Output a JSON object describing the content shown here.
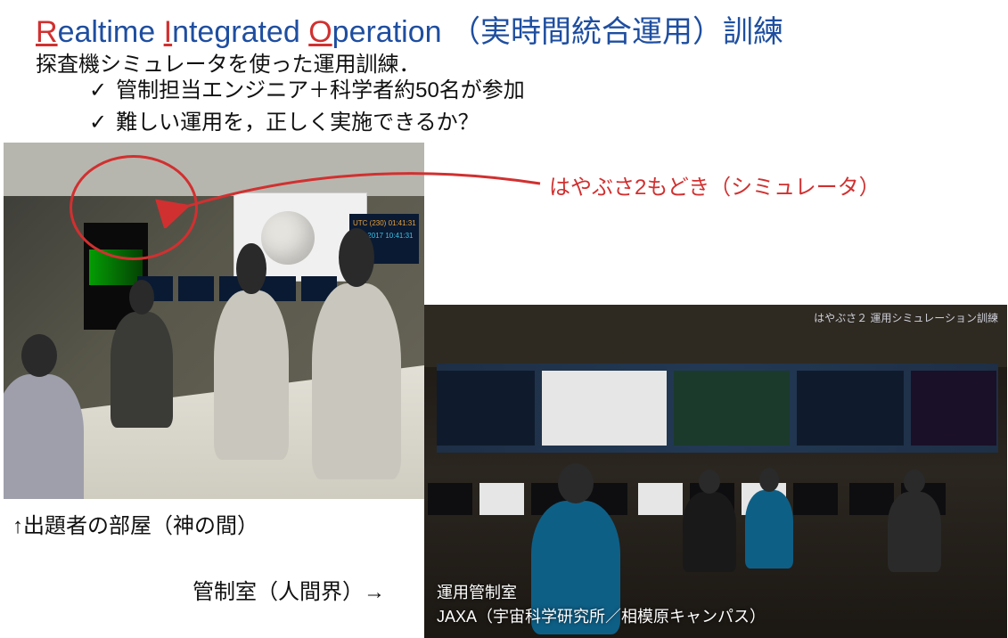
{
  "title": {
    "r": "R",
    "after_r": "ealtime ",
    "i": "I",
    "after_i": "ntegrated ",
    "o": "O",
    "after_o": "peration （実時間統合運用）訓練"
  },
  "subtitle": "探査機シミュレータを使った運用訓練．",
  "bullets": [
    "管制担当エンジニア＋科学者約50名が参加",
    "難しい運用を，正しく実施できるか？"
  ],
  "annotation_label": "はやぶさ2もどき（シミュレータ）",
  "caption_left": "↑出題者の部屋（神の間）",
  "caption_right": "管制室（人間界）→",
  "photo_left": {
    "utc_line": "UTC (230) 01:41:31",
    "jst_line": "JST 2017 10:41:31"
  },
  "photo_right": {
    "banner": "はやぶさ２ 運用シミュレーション訓練",
    "caption_line1": "運用管制室",
    "caption_line2": "JAXA（宇宙科学研究所／相模原キャンパス）"
  }
}
